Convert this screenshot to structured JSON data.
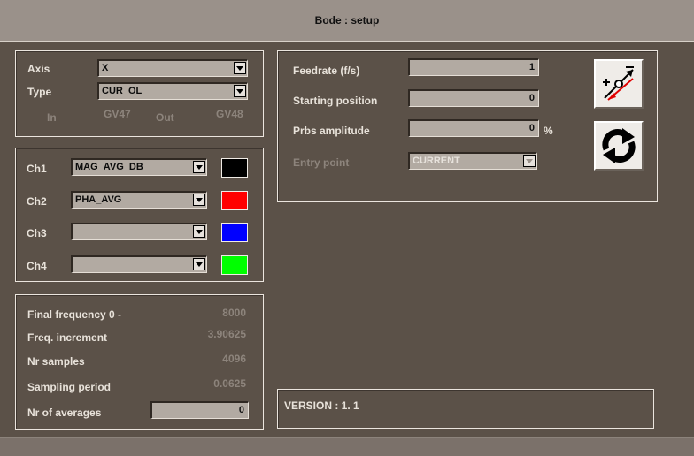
{
  "window": {
    "title": "Bode : setup"
  },
  "axis_panel": {
    "axis_label": "Axis",
    "axis_value": "X",
    "type_label": "Type",
    "type_value": "CUR_OL",
    "in_label": "In",
    "in_value": "GV47",
    "out_label": "Out",
    "out_value": "GV48"
  },
  "channels": [
    {
      "label": "Ch1",
      "value": "MAG_AVG_DB",
      "color": "#000000"
    },
    {
      "label": "Ch2",
      "value": "PHA_AVG",
      "color": "#ff0000"
    },
    {
      "label": "Ch3",
      "value": "",
      "color": "#0000ff"
    },
    {
      "label": "Ch4",
      "value": "",
      "color": "#00ff00"
    }
  ],
  "freq_panel": {
    "final_frequency_label": "Final frequency 0 -",
    "final_frequency_value": "8000",
    "freq_increment_label": "Freq. increment",
    "freq_increment_value": "3.90625",
    "nr_samples_label": "Nr samples",
    "nr_samples_value": "4096",
    "sampling_period_label": "Sampling period",
    "sampling_period_value": "0.0625",
    "nr_averages_label": "Nr of averages",
    "nr_averages_value": "0"
  },
  "motion_panel": {
    "feedrate_label": "Feedrate (f/s)",
    "feedrate_value": "1",
    "starting_position_label": "Starting position",
    "starting_position_value": "0",
    "prbs_amplitude_label": "Prbs amplitude",
    "prbs_amplitude_value": "0",
    "prbs_unit": "%",
    "entry_point_label": "Entry point",
    "entry_point_value": "CURRENT"
  },
  "version": {
    "text": "VERSION : 1. 1"
  },
  "icons": {
    "tune": "plus-minus-tune-icon",
    "refresh": "refresh-arrows-icon"
  }
}
